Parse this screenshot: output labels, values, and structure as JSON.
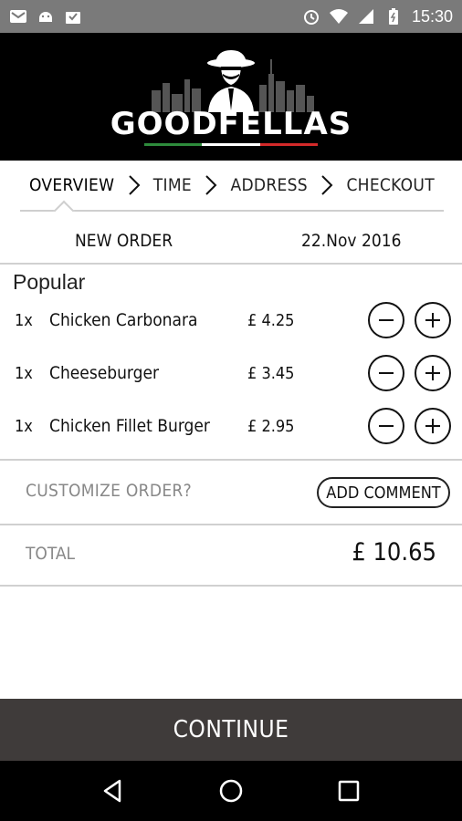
{
  "status_bar": {
    "time": "15:30",
    "left_icons": [
      "gmail-icon",
      "android-icon",
      "download-icon"
    ],
    "right_icons": [
      "alarm-icon",
      "wifi-icon",
      "signal-icon",
      "battery-icon"
    ]
  },
  "header": {
    "brand": "GOODFELLAS",
    "flag_colors": [
      "#2e8b3c",
      "#ffffff",
      "#d42a2a"
    ]
  },
  "steps": [
    {
      "label": "OVERVIEW",
      "active": true
    },
    {
      "label": "TIME",
      "active": false
    },
    {
      "label": "ADDRESS",
      "active": false
    },
    {
      "label": "CHECKOUT",
      "active": false
    }
  ],
  "order": {
    "label": "NEW ORDER",
    "date": "22.Nov 2016"
  },
  "popular": {
    "title": "Popular",
    "items": [
      {
        "qty": "1x",
        "name": "Chicken Carbonara",
        "price": "£ 4.25"
      },
      {
        "qty": "1x",
        "name": "Cheeseburger",
        "price": "£ 3.45"
      },
      {
        "qty": "1x",
        "name": "Chicken Fillet Burger",
        "price": "£ 2.95"
      }
    ]
  },
  "customize": {
    "prompt": "CUSTOMIZE ORDER?",
    "comment_button": "ADD COMMENT"
  },
  "total": {
    "label": "TOTAL",
    "value": "£ 10.65"
  },
  "continue_button": "CONTINUE",
  "colors": {
    "header_bg": "#000000",
    "status_bg": "#7a7a7a",
    "continue_bg": "#3f3b3a"
  }
}
